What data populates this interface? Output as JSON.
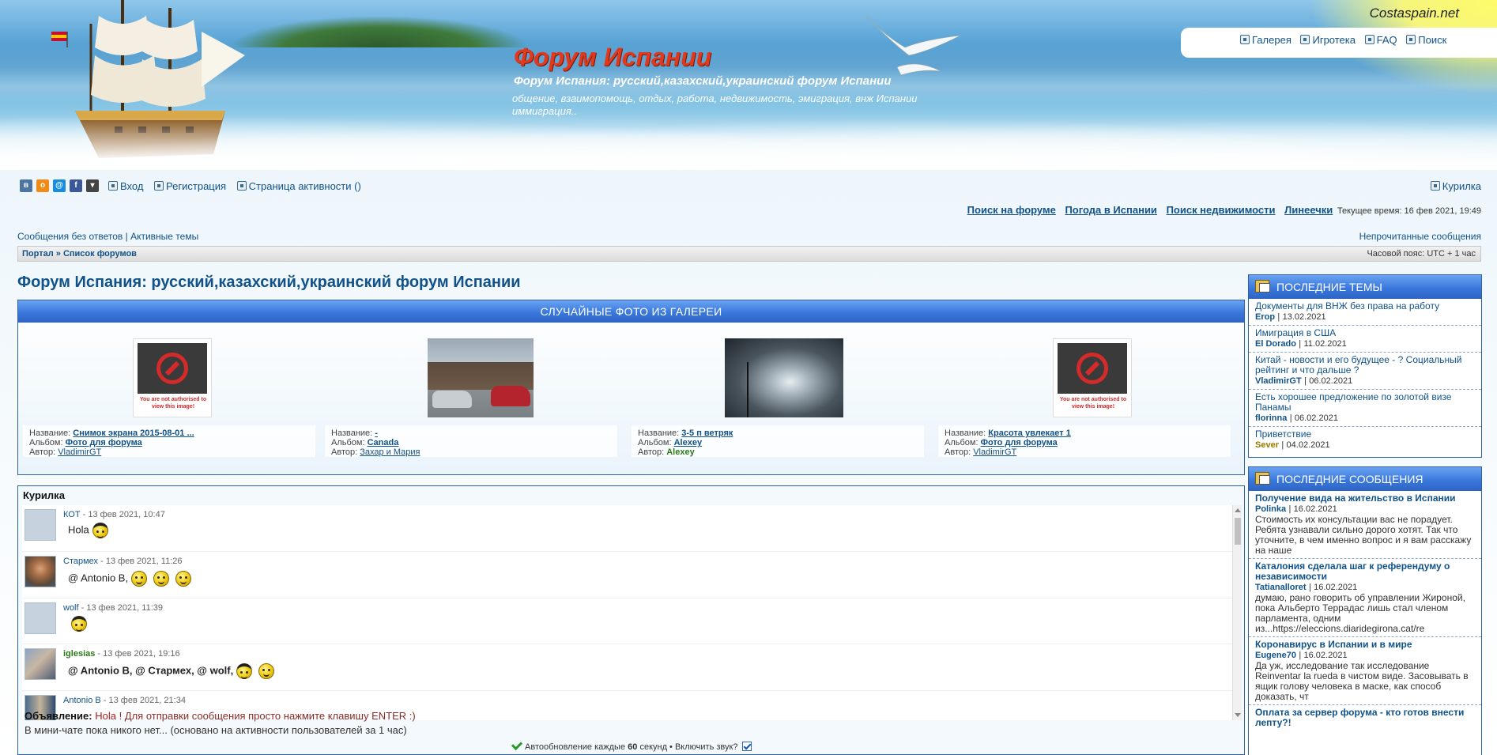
{
  "header": {
    "brand": "Costaspain.net",
    "title": "Форум Испании",
    "subtitle": "Форум Испания: русский,казахский,украинский форум Испании",
    "description": "общение, взаимопомощь, отдых, работа, недвижимость, эмиграция, внж Испании иммиграция..",
    "top_links": [
      "Галерея",
      "Игротека",
      "FAQ",
      "Поиск"
    ]
  },
  "social": [
    "vk",
    "ok",
    "mail",
    "facebook",
    "dropdown"
  ],
  "nav": {
    "login": "Вход",
    "register": "Регистрация",
    "activity": "Страница активности ()",
    "smoke_room": "Курилка"
  },
  "quicklinks": {
    "items": [
      "Поиск на форуме",
      "Погода в Испании",
      "Поиск недвижимости",
      "Линеечки"
    ],
    "time": "Текущее время: 16 фев 2021, 19:49"
  },
  "subnav": {
    "left": "Сообщения без ответов | Активные темы",
    "right": "Непрочитанные сообщения"
  },
  "breadcrumb": {
    "portal": "Портал",
    "sep": "»",
    "list": "Список форумов",
    "timezone": "Часовой пояс: UTC + 1 час"
  },
  "page_title": "Форум Испания: русский,казахский,украинский форум Испании",
  "gallery": {
    "heading": "СЛУЧАЙНЫЕ ФОТО ИЗ ГАЛЕРЕИ",
    "noauth_text": "You are not authorised to view this image!",
    "labels": {
      "name": "Название:",
      "album": "Альбом:",
      "author": "Автор:"
    },
    "photos": [
      {
        "name": "Снимок экрана 2015-08-01 ...",
        "album": "Фото для форума",
        "author": "VladimirGT"
      },
      {
        "name": "-",
        "album": "Canada",
        "author": "Захар и Мария"
      },
      {
        "name": "3-5 п ветряк",
        "album": "Alexey",
        "author": "Alexey"
      },
      {
        "name": "Красота увлекает 1",
        "album": "Фото для форума",
        "author": "VladimirGT"
      }
    ]
  },
  "chat": {
    "heading": "Курилка",
    "messages": [
      {
        "user": "КОТ",
        "time": " - 13 фев 2021, 10:47",
        "text": "Hola"
      },
      {
        "user": "Стармех",
        "time": " - 13 фев 2021, 11:26",
        "text": "@ Antonio B,"
      },
      {
        "user": "wolf",
        "time": " - 13 фев 2021, 11:39",
        "text": ""
      },
      {
        "user": "iglesias",
        "time": " - 13 фев 2021, 19:16",
        "text": "@ Antonio B, @ Стармех, @ wolf,"
      },
      {
        "user": "Antonio B",
        "time": " - 13 фев 2021, 21:34",
        "text": ""
      }
    ],
    "announce_label": "Объявление:",
    "announce_hola": "Hola",
    "announce_text": " ! Для отправки сообщения просто нажмите клавишу ENTER :)",
    "online": "В мини-чате пока никого нет... (основано на активности пользователей за 1 час)",
    "autorefresh_pre": "Автообновление каждые ",
    "autorefresh_num": "60",
    "autorefresh_post": " секунд • Включить звук?",
    "sound_enabled": true
  },
  "latest_topics": {
    "heading": "ПОСЛЕДНИЕ ТЕМЫ",
    "items": [
      {
        "title": "Документы для ВНЖ без права на работу",
        "author": "Erop",
        "date": "13.02.2021"
      },
      {
        "title": "Имиграция в США",
        "author": "El Dorado",
        "date": "11.02.2021"
      },
      {
        "title": "Китай - новости и его будущее - ? Социальный рейтинг и что дальше ?",
        "author": "VladimirGT",
        "date": "06.02.2021"
      },
      {
        "title": "Есть хорошее предложение по золотой визе Панамы",
        "author": "florinna",
        "date": "06.02.2021"
      },
      {
        "title": "Приветствие",
        "author": "Sever",
        "date": "04.02.2021"
      }
    ]
  },
  "latest_posts": {
    "heading": "ПОСЛЕДНИЕ СООБЩЕНИЯ",
    "items": [
      {
        "title": "Получение вида на жительство в Испании",
        "author": "Polinka",
        "date": "16.02.2021",
        "excerpt": "Стоимость их консультации вас не порадует. Ребята узнавали сильно дорого хотят. Так что уточните, в чем именно вопрос и я вам расскажу на наше"
      },
      {
        "title": "Каталония сделала шаг к референдуму о независимости",
        "author": "Tatianalloret",
        "date": "16.02.2021",
        "excerpt": "думаю, рано говорить об управлении Жироной, пока Альберто Террадас лишь стал членом парламента, одним из...https://eleccions.diaridegirona.cat/re"
      },
      {
        "title": "Коронавирус в Испании и в мире",
        "author": "Eugene70",
        "date": "16.02.2021",
        "excerpt": "Да уж, исследование так исследование Reinventar la rueda в чистом виде. Засовывать в ящик голову человека в маске, как способ доказать, чт"
      },
      {
        "title": "Оплата за сервер форума - кто готов внести лепту?!",
        "author": "",
        "date": "",
        "excerpt": ""
      }
    ]
  },
  "colors": {
    "link": "#105289",
    "accent_blue": "#3a78dc",
    "title_red": "#e03a1e"
  }
}
